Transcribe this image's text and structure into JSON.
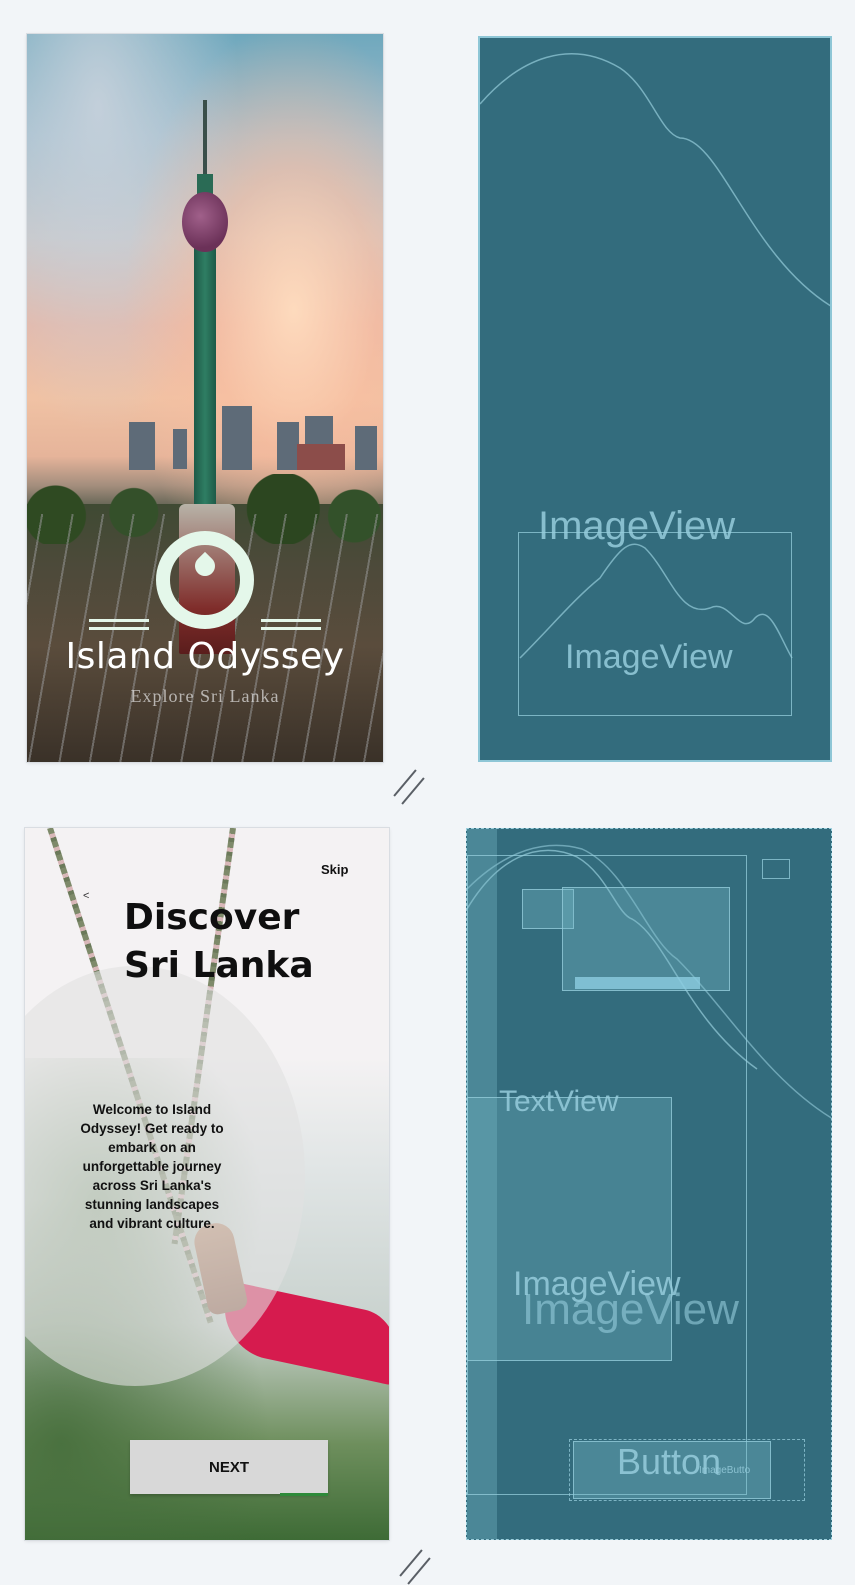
{
  "splash": {
    "title": "Island Odyssey",
    "subtitle": "Explore Sri Lanka"
  },
  "blueprint_splash": {
    "background_label": "ImageView",
    "logo_label": "ImageView"
  },
  "onboarding": {
    "skip_label": "Skip",
    "back_glyph": "<",
    "heading_line1": "Discover",
    "heading_line2": "Sri Lanka",
    "welcome_text": "Welcome to Island Odyssey! Get ready to embark on an unforgettable journey across Sri Lanka's stunning landscapes and vibrant culture.",
    "next_label": "NEXT"
  },
  "blueprint_onboarding": {
    "textview_label": "TextView",
    "imageview_label_1": "ImageView",
    "imageview_label_2": "ImageView",
    "button_label": "Button",
    "imagebutton_label": "ImageButto"
  },
  "colors": {
    "blueprint": "#336c7d",
    "logo": "#e4f7ea",
    "accent_red": "#d61b4e"
  }
}
